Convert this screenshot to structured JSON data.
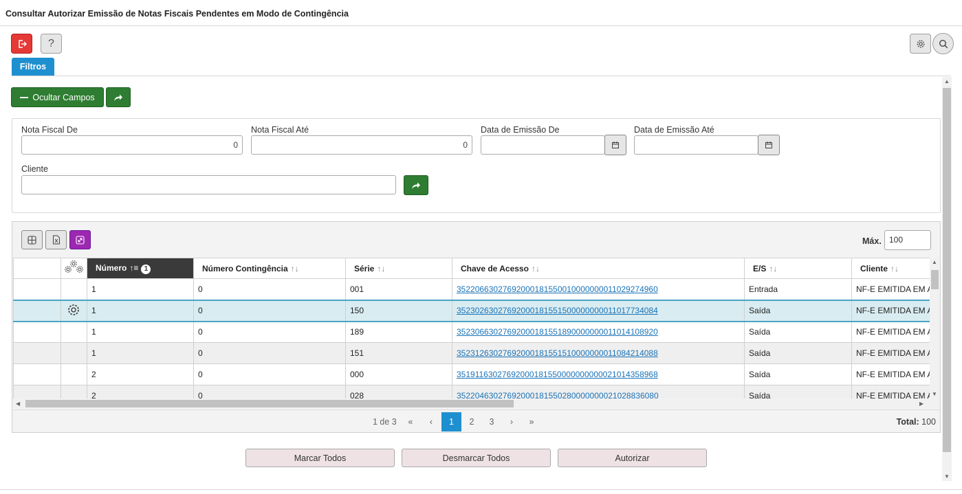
{
  "window": {
    "title": "Consultar Autorizar Emissão de Notas Fiscais Pendentes em Modo de Contingência"
  },
  "toolbar": {
    "help_label": "?",
    "exit_icon": "exit-icon",
    "settings_icon": "gear-icon",
    "search_icon": "search-icon"
  },
  "tabs": [
    {
      "label": "Filtros"
    }
  ],
  "filters": {
    "hide_fields_label": "Ocultar Campos",
    "nota_de": {
      "label": "Nota Fiscal De",
      "value": "0"
    },
    "nota_ate": {
      "label": "Nota Fiscal Até",
      "value": "0"
    },
    "emissao_de": {
      "label": "Data de Emissão De",
      "value": ""
    },
    "emissao_ate": {
      "label": "Data de Emissão Até",
      "value": ""
    },
    "cliente": {
      "label": "Cliente",
      "value": ""
    }
  },
  "grid": {
    "max_label": "Máx.",
    "max_value": "100",
    "sort_badge": "1",
    "columns": [
      {
        "label": ""
      },
      {
        "label": ""
      },
      {
        "label": "Número"
      },
      {
        "label": "Número Contingência"
      },
      {
        "label": "Série"
      },
      {
        "label": "Chave de Acesso"
      },
      {
        "label": "E/S"
      },
      {
        "label": "Cliente"
      }
    ],
    "rows": [
      {
        "numero": "1",
        "contingencia": "0",
        "serie": "001",
        "chave": "35220663027692000181550010000000011029274960",
        "es": "Entrada",
        "cliente": "NF-E EMITIDA EM AMBIENTE DE HOMOLOGACAO"
      },
      {
        "numero": "1",
        "contingencia": "0",
        "serie": "150",
        "chave": "35230263027692000181551500000000011017734084",
        "es": "Saída",
        "cliente": "NF-E EMITIDA EM AMBIENTE DE HOMOLOGACAO"
      },
      {
        "numero": "1",
        "contingencia": "0",
        "serie": "189",
        "chave": "35230663027692000181551890000000011014108920",
        "es": "Saída",
        "cliente": "NF-E EMITIDA EM AMBIENTE DE HOMOLOGACAO"
      },
      {
        "numero": "1",
        "contingencia": "0",
        "serie": "151",
        "chave": "35231263027692000181551510000000011084214088",
        "es": "Saída",
        "cliente": "NF-E EMITIDA EM AMBIENTE DE HOMOLOGACAO"
      },
      {
        "numero": "2",
        "contingencia": "0",
        "serie": "000",
        "chave": "35191163027692000181550000000000021014358968",
        "es": "Saída",
        "cliente": "NF-E EMITIDA EM AMBIENTE DE HOMOLOGACAO"
      },
      {
        "numero": "2",
        "contingencia": "0",
        "serie": "028",
        "chave": "35220463027692000181550280000000021028836080",
        "es": "Saída",
        "cliente": "NF-E EMITIDA EM AMBIENTE DE HOMOLOGACAO"
      }
    ]
  },
  "pager": {
    "summary": "1 de 3",
    "first": "«",
    "prev": "‹",
    "pages": [
      "1",
      "2",
      "3"
    ],
    "next": "›",
    "last": "»",
    "total_label": "Total:",
    "total_value": "100"
  },
  "actions": {
    "mark_all": "Marcar Todos",
    "unmark_all": "Desmarcar Todos",
    "authorize": "Autorizar"
  },
  "colors": {
    "accent": "#1e90d0",
    "green": "#2e7d32",
    "red": "#e53935",
    "purple": "#9c27b0"
  }
}
